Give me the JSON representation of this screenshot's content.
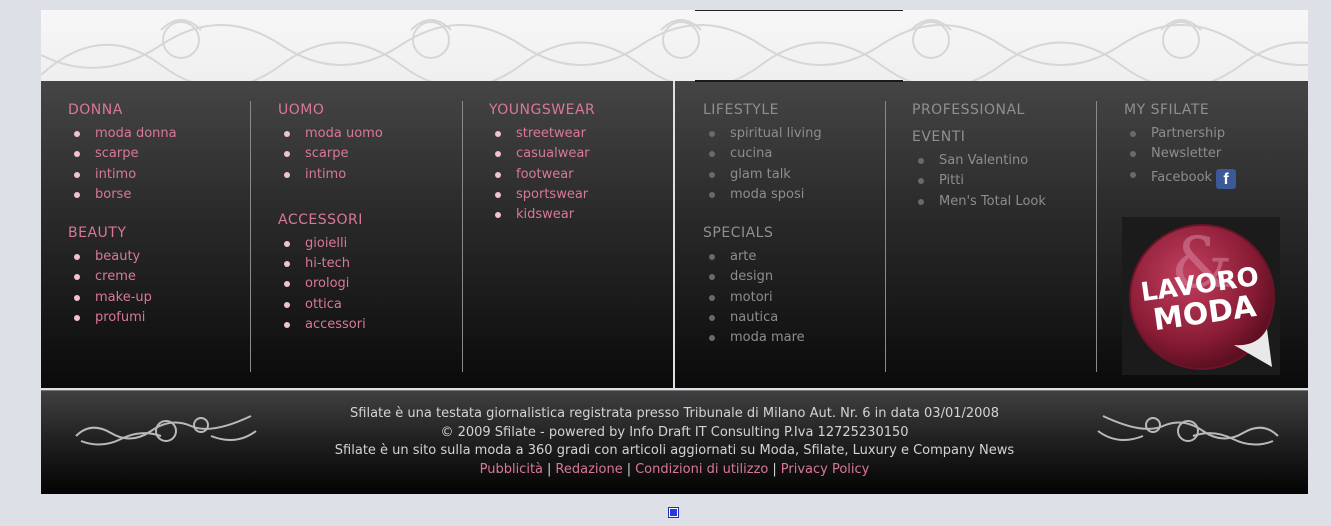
{
  "menu_left": {
    "donna": {
      "title": "DONNA",
      "items": [
        "moda donna",
        "scarpe",
        "intimo",
        "borse"
      ]
    },
    "beauty": {
      "title": "BEAUTY",
      "items": [
        "beauty",
        "creme",
        "make-up",
        "profumi"
      ]
    },
    "uomo": {
      "title": "UOMO",
      "items": [
        "moda uomo",
        "scarpe",
        "intimo"
      ]
    },
    "accessori": {
      "title": "ACCESSORI",
      "items": [
        "gioielli",
        "hi-tech",
        "orologi",
        "ottica",
        "accessori"
      ]
    },
    "youngswear": {
      "title": "YOUNGSWEAR",
      "items": [
        "streetwear",
        "casualwear",
        "footwear",
        "sportswear",
        "kidswear"
      ]
    }
  },
  "menu_right": {
    "lifestyle": {
      "title": "LIFESTYLE",
      "items": [
        "spiritual living",
        "cucina",
        "glam talk",
        "moda sposi"
      ]
    },
    "specials": {
      "title": "SPECIALS",
      "items": [
        "arte",
        "design",
        "motori",
        "nautica",
        "moda mare"
      ]
    },
    "professional": {
      "title": "PROFESSIONAL"
    },
    "eventi": {
      "title": "EVENTI",
      "items": [
        "San Valentino",
        "Pitti",
        "Men's Total Look"
      ]
    },
    "my_sfilate": {
      "title": "MY SFILATE",
      "items": [
        "Partnership",
        "Newsletter",
        "Facebook"
      ],
      "facebook_glyph": "f"
    }
  },
  "badge": {
    "line1": "LAVORO",
    "line2": "MODA",
    "amp": "&"
  },
  "footer": {
    "line1": "Sfilate è una testata giornalistica registrata presso Tribunale di Milano Aut. Nr. 6 in data 03/01/2008",
    "line2": "© 2009 Sfilate - powered by Info Draft IT Consulting P.Iva 12725230150",
    "line3": "Sfilate è un sito sulla moda a 360 gradi con articoli aggiornati su Moda, Sfilate, Luxury e Company News",
    "links": [
      "Pubblicità",
      "Redazione",
      "Condizioni di utilizzo",
      "Privacy Policy"
    ]
  },
  "colors": {
    "accent_pink": "#d9779b",
    "muted_gray": "#8d8d8d",
    "page_bg": "#dde1e7",
    "facebook_blue": "#3b5998"
  },
  "icons": [
    "facebook-icon",
    "lavoro-moda-badge",
    "ornament-left",
    "ornament-right",
    "small-blue-square-icon"
  ]
}
